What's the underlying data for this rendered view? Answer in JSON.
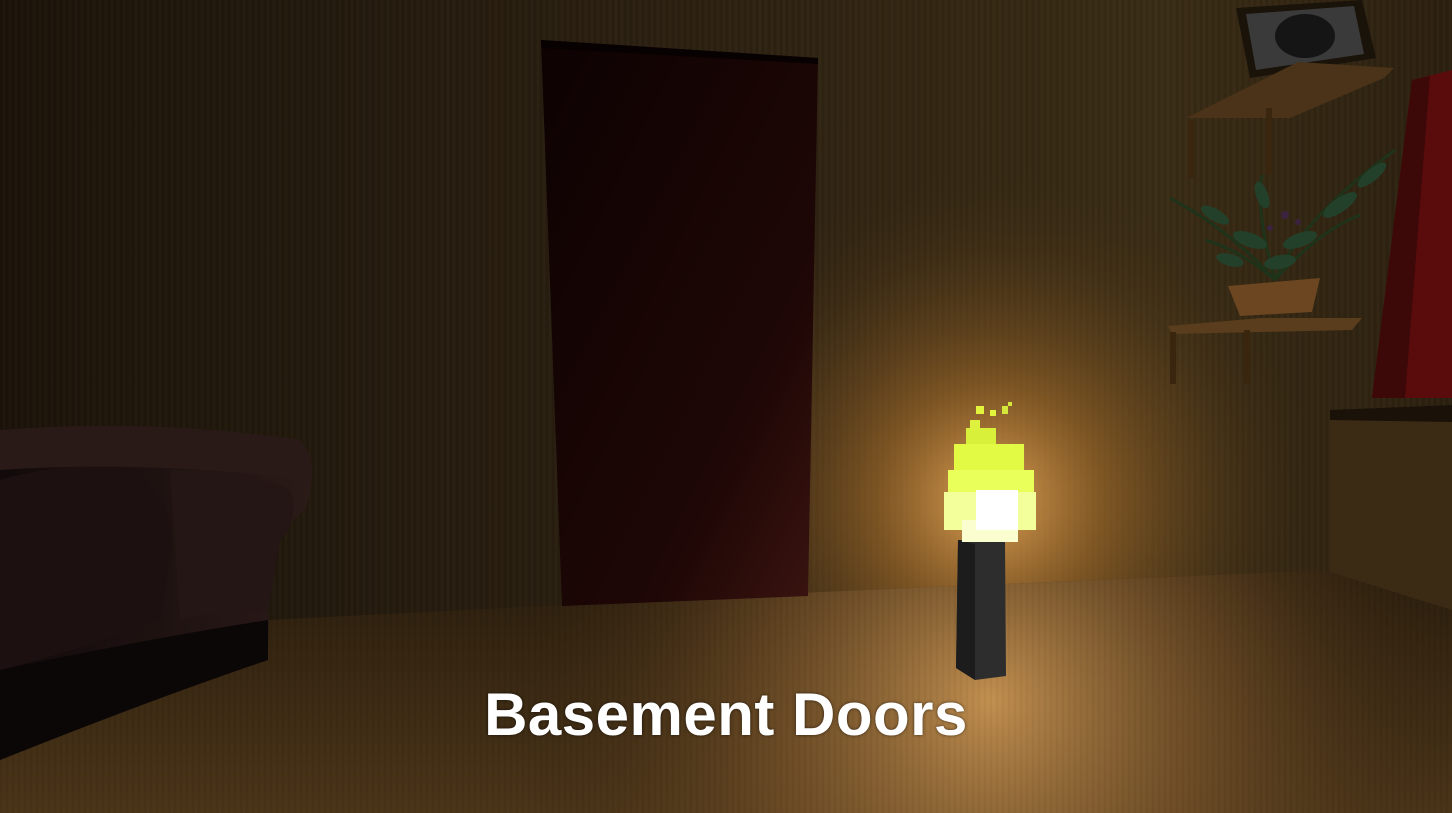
{
  "hud": {
    "subtitle": "Basement Doors"
  },
  "scene": {
    "objects": [
      "back-wall",
      "floor",
      "basement-door",
      "sofa",
      "torch",
      "wall-shelf",
      "potted-plant",
      "picture-frame",
      "red-curtain",
      "side-cabinet"
    ],
    "colors": {
      "wall": "#2f2312",
      "floor": "#3a2a14",
      "door": "#150404",
      "flame": "#e8ff4a",
      "torch_stick": "#2a2a2a"
    }
  }
}
